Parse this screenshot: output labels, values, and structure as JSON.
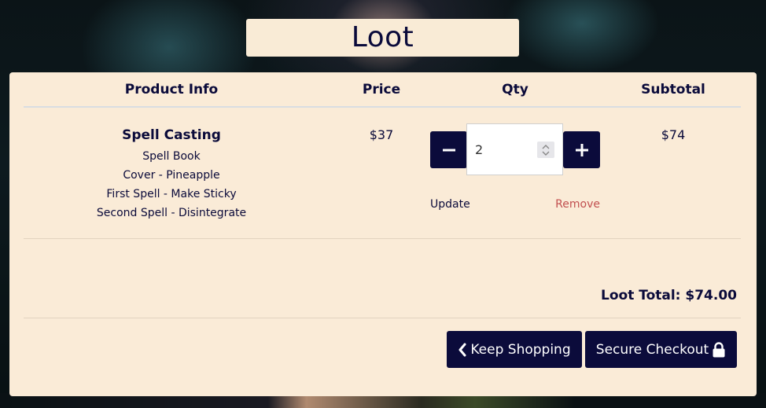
{
  "title": "Loot",
  "table": {
    "headers": {
      "product_info": "Product Info",
      "price": "Price",
      "qty": "Qty",
      "subtotal": "Subtotal"
    },
    "item": {
      "name": "Spell Casting",
      "details": [
        "Spell Book",
        "Cover - Pineapple",
        "First Spell - Make Sticky",
        "Second Spell - Disintegrate"
      ],
      "price": "$37",
      "quantity": "2",
      "subtotal": "$74",
      "update_label": "Update",
      "remove_label": "Remove"
    }
  },
  "total_label": "Loot Total: $74.00",
  "buttons": {
    "keep_shopping": "Keep Shopping",
    "secure_checkout": "Secure Checkout"
  },
  "icons": {
    "decrement": "minus-icon",
    "increment": "plus-icon",
    "back": "chevron-left-icon",
    "lock": "lock-icon"
  },
  "colors": {
    "panel": "#faebd7",
    "primary": "#0b0b3b",
    "remove": "#c14f4f"
  }
}
